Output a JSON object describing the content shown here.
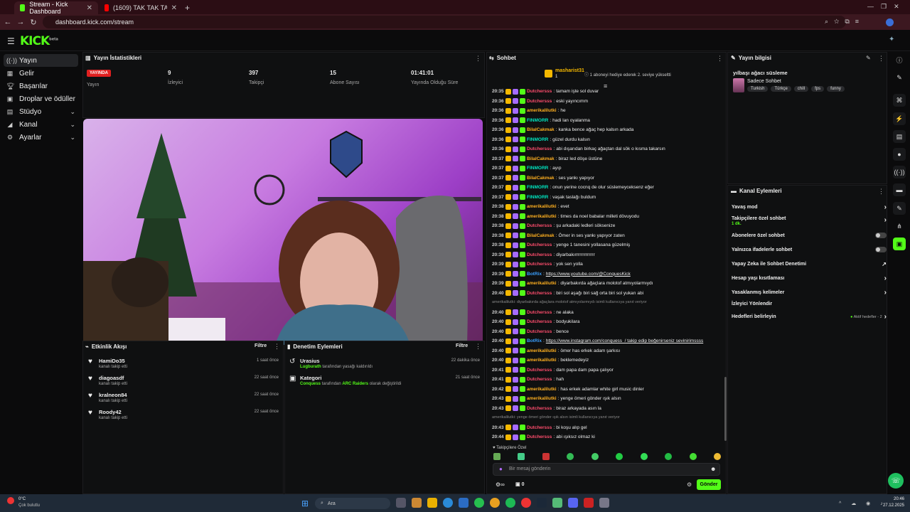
{
  "browser": {
    "tabs": [
      {
        "title": "Stream - Kick Dashboard",
        "active": true
      },
      {
        "title": "(1609) TAK TAK TAK - YouTube",
        "active": false
      }
    ],
    "url": "dashboard.kick.com/stream"
  },
  "kick": {
    "logo": "KICK",
    "logo_sup": "beta"
  },
  "sidebar": {
    "items": [
      {
        "label": "Yayın",
        "icon": "broadcast-icon"
      },
      {
        "label": "Gelir",
        "icon": "revenue-icon"
      },
      {
        "label": "Başarılar",
        "icon": "trophy-icon"
      },
      {
        "label": "Droplar ve ödüller",
        "icon": "gift-icon"
      },
      {
        "label": "Stüdyo",
        "icon": "studio-icon"
      },
      {
        "label": "Kanal",
        "icon": "channel-icon"
      },
      {
        "label": "Ayarlar",
        "icon": "gear-icon"
      }
    ]
  },
  "stats": {
    "title": "Yayın İstatistikleri",
    "live_badge": "YAYINDA",
    "items": [
      {
        "value": "",
        "label": "Yayın"
      },
      {
        "value": "9",
        "label": "İzleyici"
      },
      {
        "value": "397",
        "label": "Takipçi"
      },
      {
        "value": "15",
        "label": "Abone Sayısı"
      },
      {
        "value": "01:41:01",
        "label": "Yayında Olduğu Süre"
      }
    ]
  },
  "activity": {
    "title": "Etkinlik Akışı",
    "filter": "Filtre",
    "items": [
      {
        "name": "HamiDo35",
        "sub": "kanalı takip etti",
        "time": "1 saat önce"
      },
      {
        "name": "diagoasdf",
        "sub": "kanalı takip etti",
        "time": "22 saat önce"
      },
      {
        "name": "kralneon84",
        "sub": "kanalı takip etti",
        "time": "22 saat önce"
      },
      {
        "name": "Roody42",
        "sub": "kanalı takip etti",
        "time": "22 saat önce"
      }
    ]
  },
  "moderation": {
    "title": "Denetim Eylemleri",
    "filter": "Filtre",
    "items": [
      {
        "title": "Urasius",
        "who": "Lugburath",
        "text": "tarafından yasağı kaldırıldı",
        "time": "22 dakika önce"
      },
      {
        "title": "Kategori",
        "who": "Conquess",
        "text": "tarafından",
        "cat": "ARC Raiders",
        "text2": "olarak değiştirildi",
        "time": "21 saat önce"
      }
    ]
  },
  "chat": {
    "title": "Sohbet",
    "pinned_user": "masharist31",
    "pinned_count": "1",
    "pinned_text": "1 aboneyi hediye ederek 2. seviye yükseltti",
    "messages": [
      {
        "t": "20:35",
        "n": "Dutchersss",
        "c": "#ff4d6d",
        "m": "tamam işte sol duvar"
      },
      {
        "t": "20:36",
        "n": "Dutchersss",
        "c": "#ff4d6d",
        "m": "eski yayıncımm"
      },
      {
        "t": "20:36",
        "n": "amerikalilutki",
        "c": "#ffb020",
        "m": "he"
      },
      {
        "t": "20:36",
        "n": "FINMORR",
        "c": "#00e5c0",
        "m": "hadi lan oyalanma"
      },
      {
        "t": "20:36",
        "n": "BilalCakmak",
        "c": "#ffb020",
        "m": "kanka bence ağaç hep kalsın arkada"
      },
      {
        "t": "20:36",
        "n": "FINMORR",
        "c": "#00e5c0",
        "m": "güzel durdu kalsın"
      },
      {
        "t": "20:36",
        "n": "Dutchersss",
        "c": "#ff4d6d",
        "m": "abi dışarıdan birkaç ağaçtan dal sök o kısma takarsın"
      },
      {
        "t": "20:37",
        "n": "BilalCakmak",
        "c": "#ffb020",
        "m": "biraz led döşe üstüne"
      },
      {
        "t": "20:37",
        "n": "FINMORR",
        "c": "#00e5c0",
        "m": "ayıp"
      },
      {
        "t": "20:37",
        "n": "BilalCakmak",
        "c": "#ffb020",
        "m": "ses yankı yapıyor"
      },
      {
        "t": "20:37",
        "n": "FINMORR",
        "c": "#00e5c0",
        "m": "onun yerine cocnq de olur süslemeyceksenz eğer"
      },
      {
        "t": "20:37",
        "n": "FINMORR",
        "c": "#00e5c0",
        "m": "vaşak taslağı buldum"
      },
      {
        "t": "20:38",
        "n": "amerikalilutki",
        "c": "#ffb020",
        "m": "evet"
      },
      {
        "t": "20:38",
        "n": "amerikalilutki",
        "c": "#ffb020",
        "m": "times da noel babalar milleti dövuyodu"
      },
      {
        "t": "20:38",
        "n": "Dutchersss",
        "c": "#ff4d6d",
        "m": "şu arkadaki ledleri söksenize"
      },
      {
        "t": "20:38",
        "n": "BilalCakmak",
        "c": "#ffb020",
        "m": "Ömer in ses yankı yapıyor zaten"
      },
      {
        "t": "20:38",
        "n": "Dutchersss",
        "c": "#ff4d6d",
        "m": "yenge 1 tanesini yollasana güzelmiş"
      },
      {
        "t": "20:39",
        "n": "Dutchersss",
        "c": "#ff4d6d",
        "m": "diyarbakırrrrrrrrrrrrr"
      },
      {
        "t": "20:39",
        "n": "Dutchersss",
        "c": "#ff4d6d",
        "m": "yok sen yolla"
      },
      {
        "t": "20:39",
        "n": "BotRix",
        "c": "#3aa0ff",
        "m": "https://www.youtube.com/@ConquesKick"
      },
      {
        "t": "20:39",
        "n": "amerikalilutki",
        "c": "#ffb020",
        "m": "diyarbakırda ağaçlara molotof atmıyolarmıydı"
      },
      {
        "t": "20:40",
        "n": "Dutchersss",
        "c": "#ff4d6d",
        "m": "biri sol aşağı biri sağ orta biri sol yukarı abi"
      },
      {
        "sys": "amerikalilutki: diyarbakırda ağaçlara molotof atmıyolarmıydı isimli kullanıcıya yanıt veriyor"
      },
      {
        "t": "20:40",
        "n": "Dutchersss",
        "c": "#ff4d6d",
        "m": "ne alaka"
      },
      {
        "t": "20:40",
        "n": "Dutchersss",
        "c": "#ff4d6d",
        "m": "bodyukilara"
      },
      {
        "t": "20:40",
        "n": "Dutchersss",
        "c": "#ff4d6d",
        "m": "bence"
      },
      {
        "t": "20:40",
        "n": "BotRix",
        "c": "#3aa0ff",
        "m": "https://www.instagram.com/conquess_/ takip edip beğenirseniz sevinirimssss"
      },
      {
        "t": "20:40",
        "n": "amerikalilutki",
        "c": "#ffb020",
        "m": "ömer has erkek adam şarkısı"
      },
      {
        "t": "20:40",
        "n": "amerikalilutki",
        "c": "#ffb020",
        "m": "beklemedeyiz"
      },
      {
        "t": "20:41",
        "n": "Dutchersss",
        "c": "#ff4d6d",
        "m": "dam papa dam papa çalıyor"
      },
      {
        "t": "20:41",
        "n": "Dutchersss",
        "c": "#ff4d6d",
        "m": "hah"
      },
      {
        "t": "20:42",
        "n": "amerikalilutki",
        "c": "#ffb020",
        "m": "has erkek adamlar white girl music dinler"
      },
      {
        "t": "20:43",
        "n": "amerikalilutki",
        "c": "#ffb020",
        "m": "yenge ömeri gönder ışık alsın"
      },
      {
        "t": "20:43",
        "n": "Dutchersss",
        "c": "#ff4d6d",
        "m": "biraz arkayada asın la"
      },
      {
        "sys": "amerikalilutki: yenge ömeri gönder ışık alsın isimli kullanıcıya yanıt veriyor"
      },
      {
        "t": "20:43",
        "n": "Dutchersss",
        "c": "#ff4d6d",
        "m": "bi koşu alıp gel"
      },
      {
        "t": "20:44",
        "n": "Dutchersss",
        "c": "#ff4d6d",
        "m": "abi ışıksız olmaz ki"
      },
      {
        "t": "20:44",
        "n": "Dutchersss",
        "c": "#ff4d6d",
        "m": "yarın hal edersin"
      }
    ],
    "followers_only": "Takipçilere Özel",
    "input_placeholder": "Bir mesaj gönderin",
    "viewers_count": "0",
    "send": "Gönder"
  },
  "stream_info": {
    "title": "Yayın bilgisi",
    "stream_title": "yılbaşı ağacı süsleme",
    "category": "Sadece Sohbet",
    "tags": [
      "Turkish",
      "Türkçe",
      "chill",
      "fps",
      "funny"
    ]
  },
  "channel_actions": {
    "title": "Kanal Eylemleri",
    "rows": [
      {
        "label": "Yavaş mod",
        "kind": "arrow"
      },
      {
        "label": "Takipçilere özel sohbet",
        "sub": "1 dk.",
        "kind": "arrow"
      },
      {
        "label": "Abonelere özel sohbet",
        "kind": "toggle"
      },
      {
        "label": "Yalnızca ifadelerle sohbet",
        "kind": "toggle"
      },
      {
        "label": "Yapay Zeka ile Sohbet Denetimi",
        "kind": "ext"
      },
      {
        "label": "Hesap yaşı kısıtlaması",
        "kind": "arrow"
      },
      {
        "label": "Yasaklanmış kelimeler",
        "kind": "arrow"
      },
      {
        "label": "İzleyici Yönlendir",
        "kind": "none"
      },
      {
        "label": "Hedefleri belirleyin",
        "kind": "goal",
        "extra": "Aktif hedefler - 2"
      }
    ]
  },
  "taskbar": {
    "weather_temp": "0°C",
    "weather_text": "Çok bulutlu",
    "search": "Ara",
    "time": "20:46",
    "date": "27.12.2025"
  },
  "colors": {
    "brand": "#53fc18",
    "live": "#e02020",
    "bg": "#0b0b0c"
  }
}
